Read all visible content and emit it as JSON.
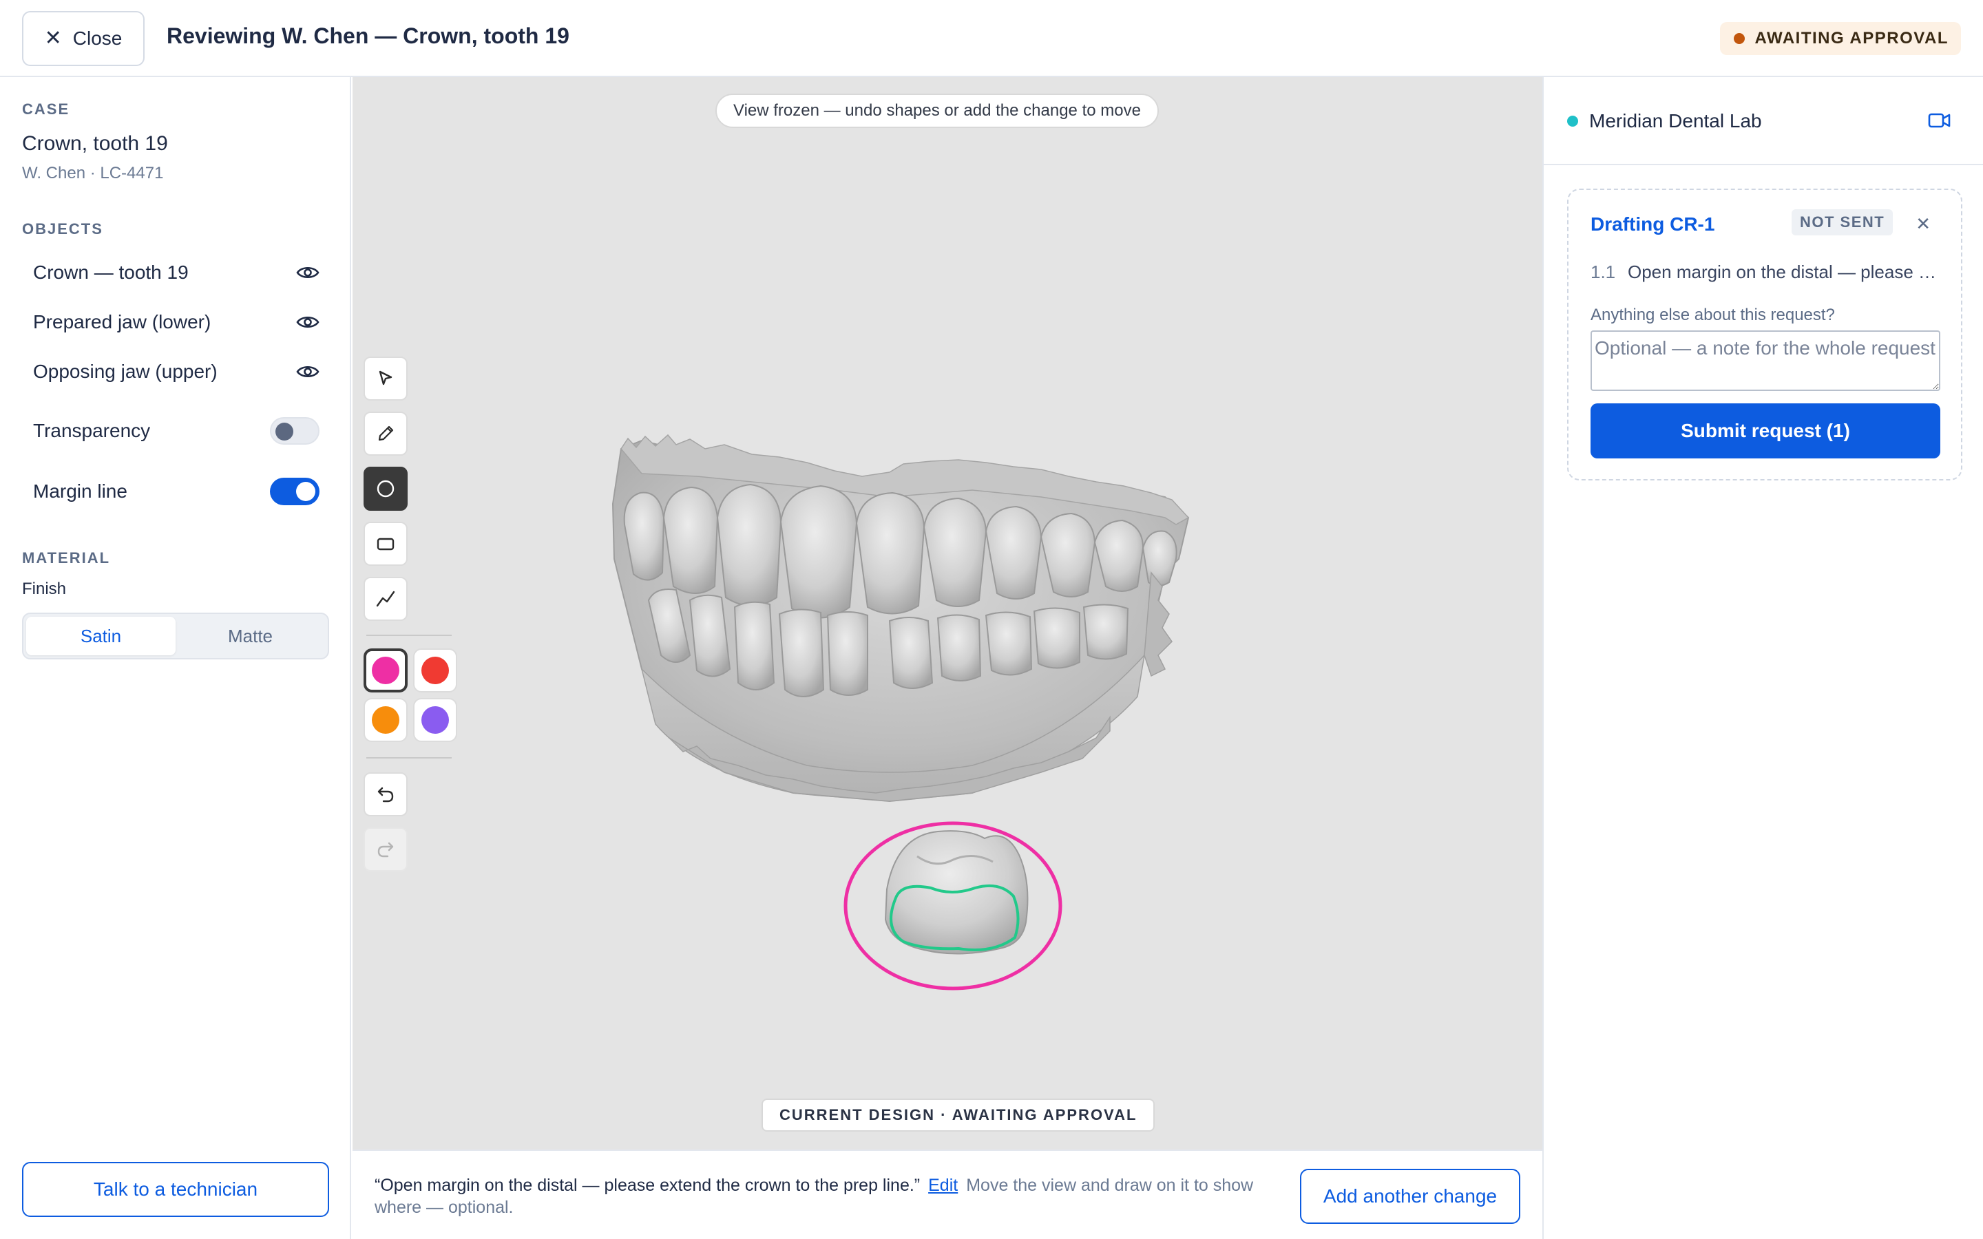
{
  "header": {
    "close_label": "Close",
    "title": "Reviewing W. Chen — Crown, tooth 19",
    "status": "AWAITING APPROVAL",
    "status_color": "#c2560c"
  },
  "sidebar": {
    "case_label": "CASE",
    "case_title": "Crown, tooth 19",
    "case_sub": "W. Chen · LC-4471",
    "objects_label": "OBJECTS",
    "objects": [
      {
        "label": "Crown — tooth 19",
        "icon": "eye-icon",
        "visible": true
      },
      {
        "label": "Prepared jaw (lower)",
        "icon": "eye-icon",
        "visible": true
      },
      {
        "label": "Opposing jaw (upper)",
        "icon": "eye-icon",
        "visible": true
      }
    ],
    "toggles": [
      {
        "label": "Transparency",
        "on": false
      },
      {
        "label": "Margin line",
        "on": true
      }
    ],
    "material_label": "MATERIAL",
    "finish_label": "Finish",
    "finish_options": [
      "Satin",
      "Matte"
    ],
    "finish_selected": "Satin",
    "talk_label": "Talk to a technician"
  },
  "viewport": {
    "frozen_notice": "View frozen — undo shapes or add the change to move",
    "design_status": "CURRENT DESIGN · AWAITING APPROVAL",
    "tools": [
      "select-pointer-icon",
      "pencil-icon",
      "ellipse-icon",
      "rectangle-icon",
      "polyline-icon"
    ],
    "active_tool": "ellipse-icon",
    "colors": [
      "#ee2fa4",
      "#f03a32",
      "#f78d0c",
      "#8a5cf0"
    ],
    "selected_color": "#ee2fa4",
    "annotation_color": "#ee2fa4",
    "margin_line_color": "#22c98a"
  },
  "bottom": {
    "quote": "“Open margin on the distal — please extend the crown to the prep line.”",
    "edit_label": "Edit",
    "helper": "Move the view and draw on it to show where — optional.",
    "add_label": "Add another change"
  },
  "rpanel": {
    "lab_name": "Meridian Dental Lab",
    "lab_status_color": "#1fc0c8",
    "draft_title": "Drafting CR-1",
    "draft_status": "NOT SENT",
    "item_num": "1.1",
    "item_text": "Open margin on the distal — please extend the crown to the prep line.",
    "else_label": "Anything else about this request?",
    "note_placeholder": "Optional — a note for the whole request",
    "submit_label": "Submit request (1)"
  }
}
